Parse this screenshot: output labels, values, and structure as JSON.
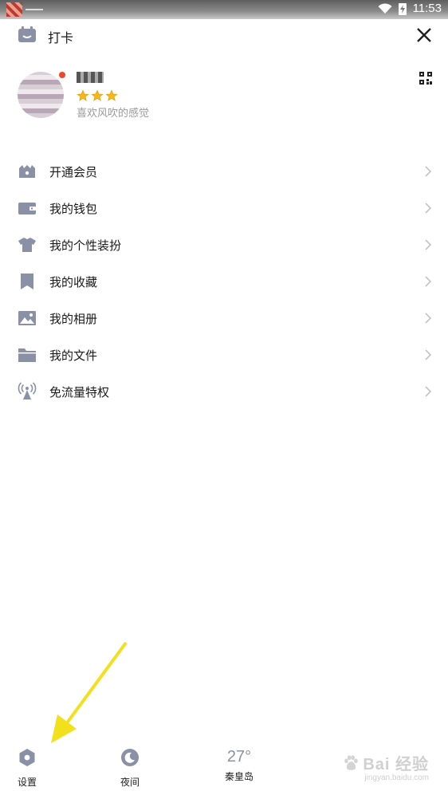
{
  "status_bar": {
    "time": "11:53"
  },
  "top": {
    "checkin_label": "打卡"
  },
  "profile": {
    "signature": "喜欢风吹的感觉",
    "level_stars": 3
  },
  "menu": [
    {
      "label": "开通会员",
      "icon": "vip-shop-icon"
    },
    {
      "label": "我的钱包",
      "icon": "wallet-icon"
    },
    {
      "label": "我的个性装扮",
      "icon": "tshirt-icon"
    },
    {
      "label": "我的收藏",
      "icon": "bookmark-icon"
    },
    {
      "label": "我的相册",
      "icon": "photo-icon"
    },
    {
      "label": "我的文件",
      "icon": "folder-icon"
    },
    {
      "label": "免流量特权",
      "icon": "signal-tower-icon"
    }
  ],
  "bottom": {
    "settings_label": "设置",
    "night_label": "夜间",
    "weather_temp": "27°",
    "weather_city": "秦皇岛"
  },
  "watermark": {
    "main": "Bai 经验",
    "sub": "jingyan.baidu.com"
  },
  "colors": {
    "icon": "#8a90a6",
    "accent_dot": "#f0442c",
    "arrow": "#f2e01c"
  }
}
